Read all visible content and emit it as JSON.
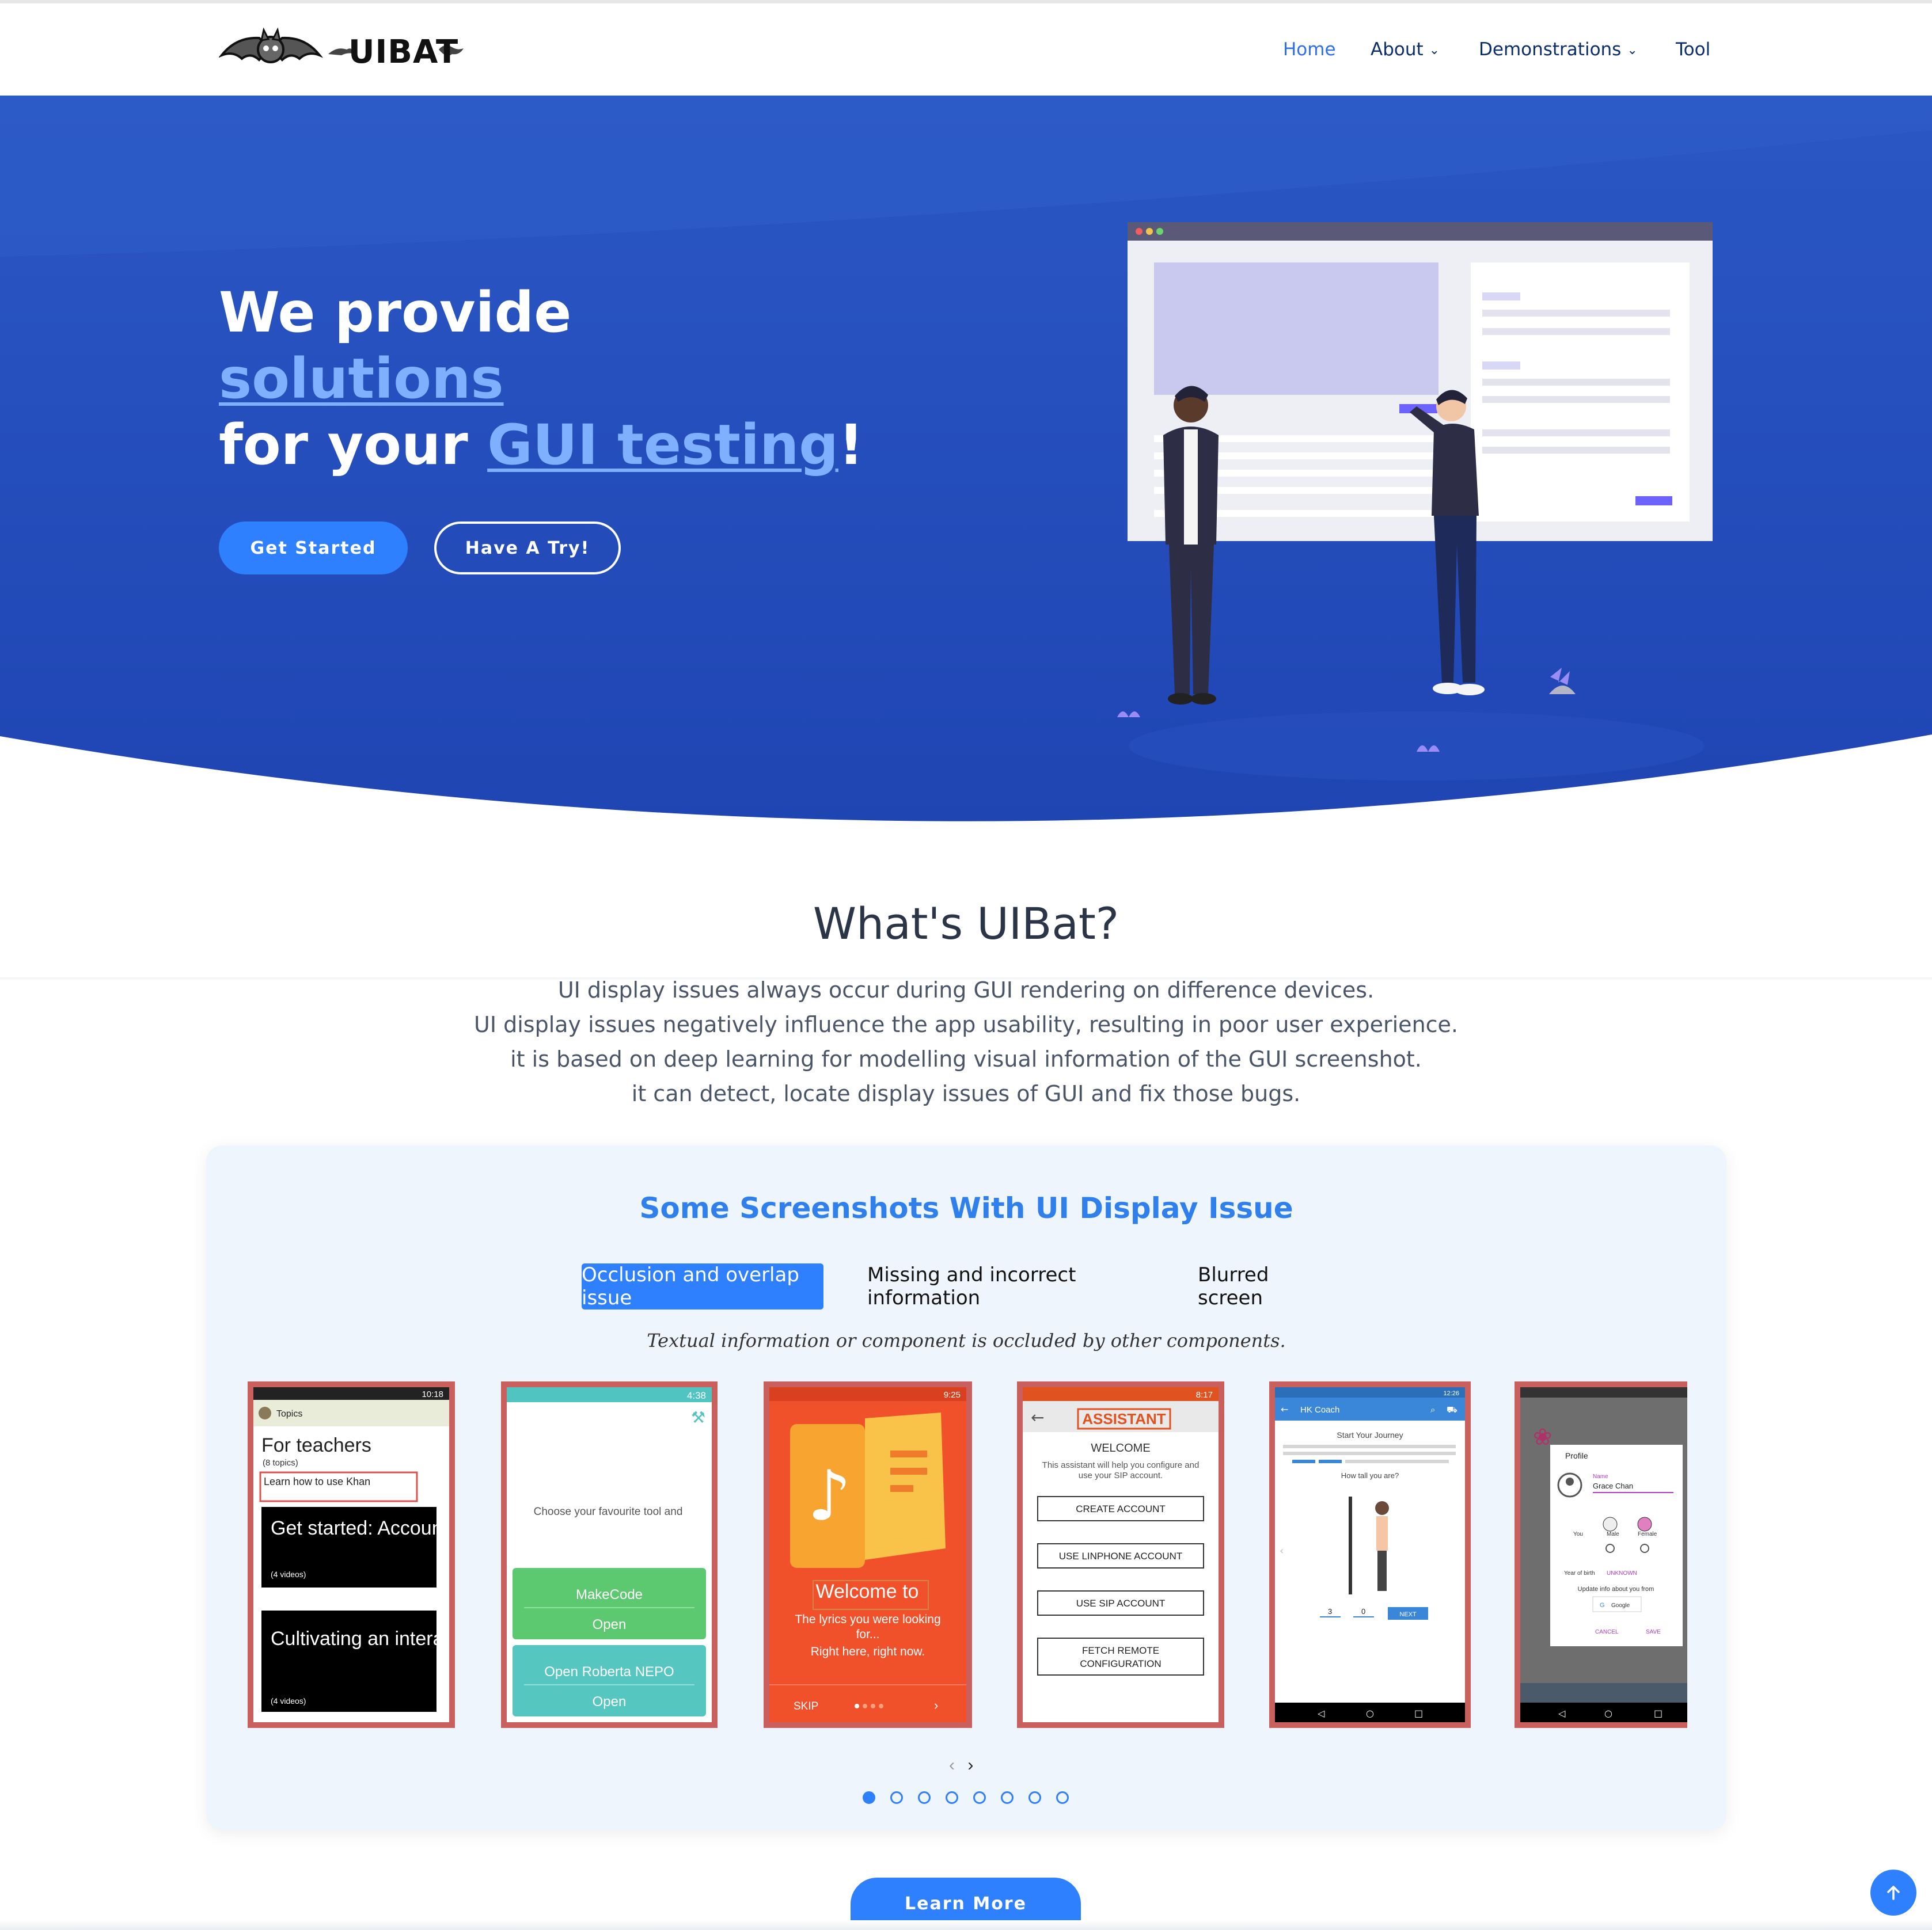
{
  "brand": {
    "name": "UIBAT"
  },
  "nav": {
    "home": "Home",
    "about": "About",
    "demonstrations": "Demonstrations",
    "tool": "Tool"
  },
  "hero": {
    "line1": "We provide",
    "highlight1": "solutions",
    "line3_prefix": "for your ",
    "highlight2": "GUI testing",
    "line3_suffix": "!",
    "get_started": "Get Started",
    "have_a_try": "Have A Try!"
  },
  "about": {
    "title": "What's UIBat?",
    "lines": [
      "UI display issues always occur during GUI rendering on difference devices.",
      "UI display issues negatively influence the app usability, resulting in poor user experience.",
      "it is based on deep learning for modelling visual information of the GUI screenshot.",
      "it can detect, locate display issues of GUI and fix those bugs."
    ]
  },
  "screenshots": {
    "title": "Some Screenshots With UI Display Issue",
    "tabs": [
      "Occlusion and overlap issue",
      "Missing and incorrect information",
      "Blurred screen"
    ],
    "caption": "Textual information or component is occluded by other components.",
    "phone1": {
      "time": "10:18",
      "bar": "Topics",
      "heading": "For teachers",
      "sub": "(8 topics)",
      "link": "Learn how to use Khan",
      "tile1_title": "Get started: Accounts an...",
      "tile1_sub": "(4 videos)",
      "tile2_title": "Cultivating an interactive...",
      "tile2_sub": "(4 videos)"
    },
    "phone2": {
      "time": "4:38",
      "prompt": "Choose your favourite tool and",
      "btn1": "MakeCode",
      "btn1_action": "Open",
      "btn2": "Open Roberta NEPO",
      "btn2_action": "Open"
    },
    "phone3": {
      "time": "9:25",
      "welcome": "Welcome to",
      "tagline1": "The lyrics you were looking",
      "tagline2": "for...",
      "tagline3": "Right here, right now.",
      "skip": "SKIP",
      "next": "›"
    },
    "phone4": {
      "time": "8:17",
      "title": "ASSISTANT",
      "welcome": "WELCOME",
      "desc1": "This assistant will help you configure and",
      "desc2": "use your SIP account.",
      "b1": "CREATE ACCOUNT",
      "b2": "USE LINPHONE ACCOUNT",
      "b3": "USE SIP ACCOUNT",
      "b4a": "FETCH REMOTE",
      "b4b": "CONFIGURATION"
    },
    "phone5": {
      "time": "12:26",
      "bar": "HK Coach",
      "heading": "Start Your Journey",
      "q": "How tall you are?",
      "ft": "3",
      "in": "0",
      "next": "NEXT"
    },
    "phone6": {
      "time": "",
      "profile": "Profile",
      "name_label": "Name",
      "name": "Grace Chan",
      "you": "You",
      "male": "Male",
      "female": "Female",
      "yob": "Year of birth",
      "yob_value": "UNKNOWN",
      "update": "Update info about you from",
      "google": "Google",
      "cancel": "CANCEL",
      "save": "SAVE"
    },
    "pager_count": 8,
    "pager_active": 1
  },
  "footer_cta": {
    "learn_more": "Learn More"
  },
  "colors": {
    "hero_blue": "#2247b7",
    "accent": "#2f80ff",
    "highlight": "#7fb0ff",
    "phone_border": "#c9605d",
    "title_dark": "#2b3548"
  }
}
